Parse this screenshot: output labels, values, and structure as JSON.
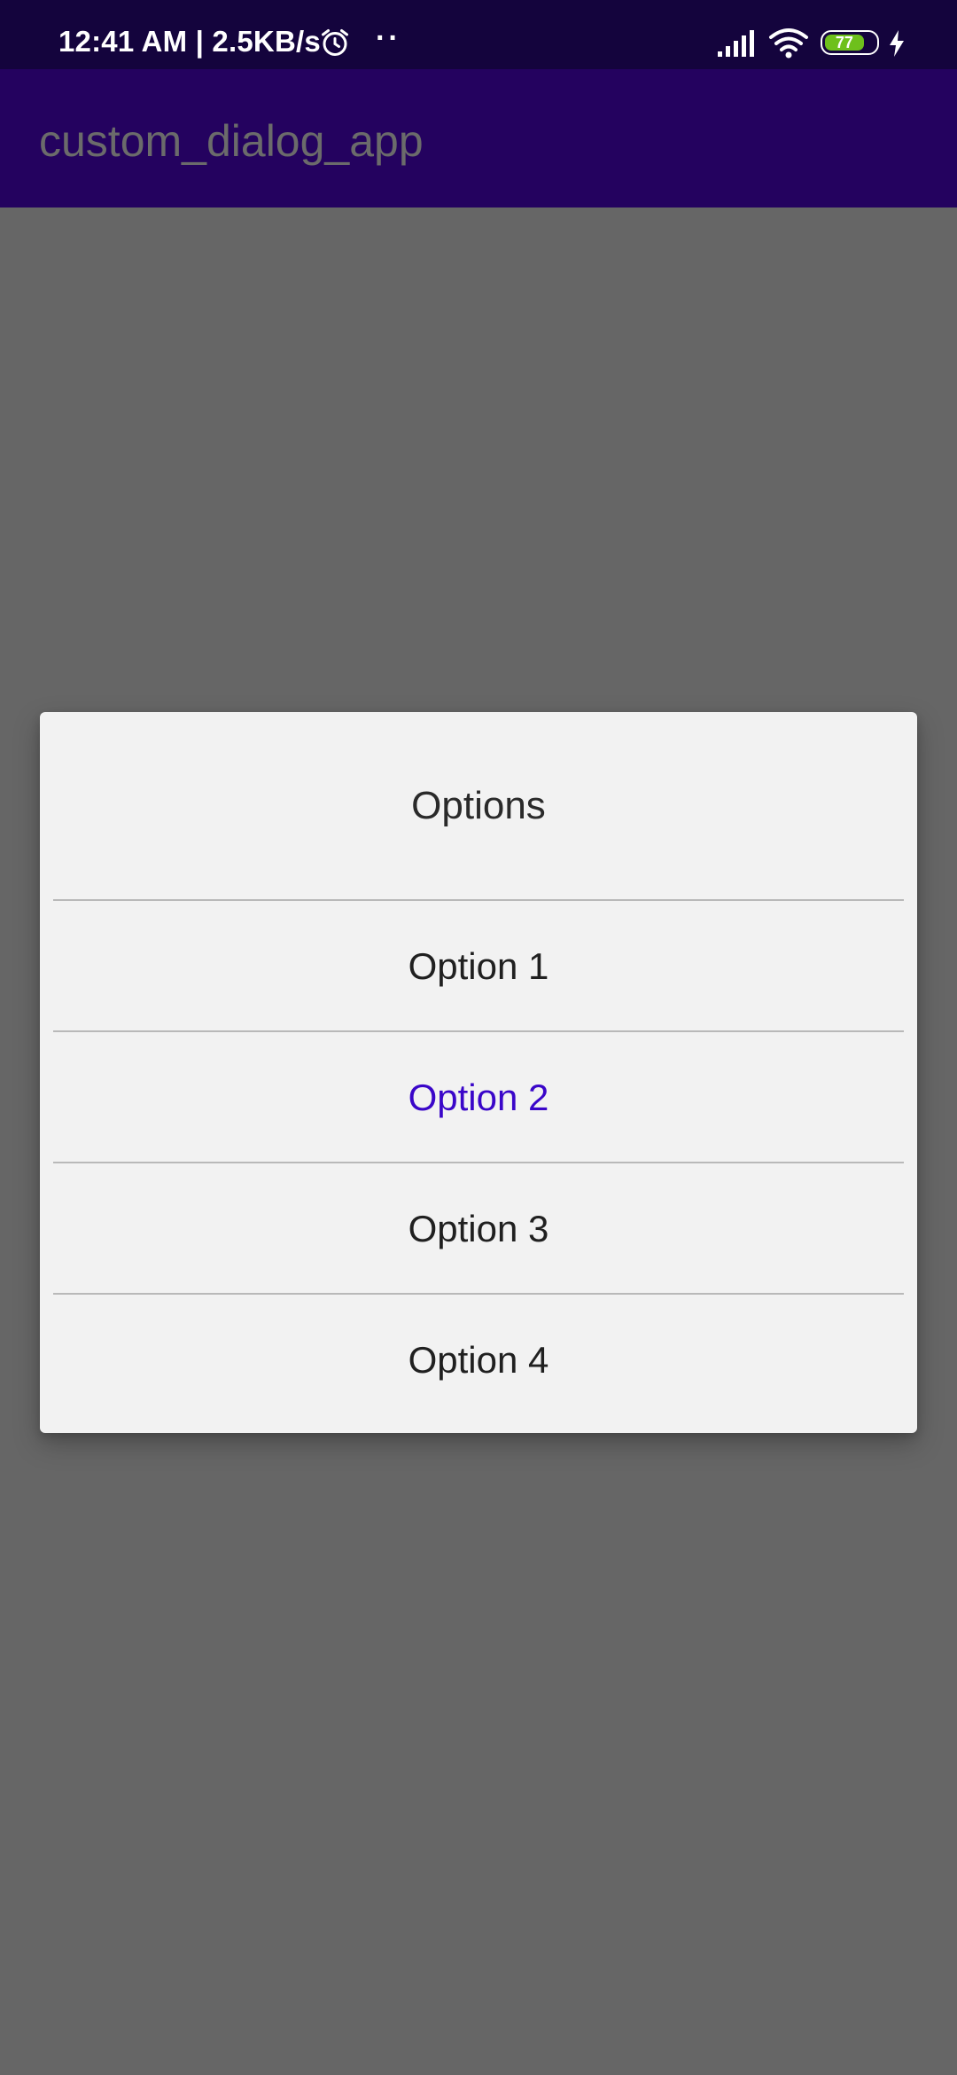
{
  "status_bar": {
    "time_speed": "12:41 AM | 2.5KB/s",
    "dots": "··",
    "battery_level": "77",
    "icons": [
      "alarm-icon",
      "signal-icon",
      "wifi-icon",
      "battery-icon",
      "charging-icon"
    ]
  },
  "app_bar": {
    "title": "custom_dialog_app"
  },
  "dialog": {
    "title": "Options",
    "options": [
      {
        "label": "Option 1",
        "selected": false
      },
      {
        "label": "Option 2",
        "selected": true
      },
      {
        "label": "Option 3",
        "selected": false
      },
      {
        "label": "Option 4",
        "selected": false
      }
    ]
  },
  "colors": {
    "status_bar": "#14043d",
    "app_bar": "#24025f",
    "scrim": "#666666",
    "dialog_bg": "#f2f2f2",
    "selected_option": "#3a06c9",
    "battery_fill": "#6ec01c"
  }
}
